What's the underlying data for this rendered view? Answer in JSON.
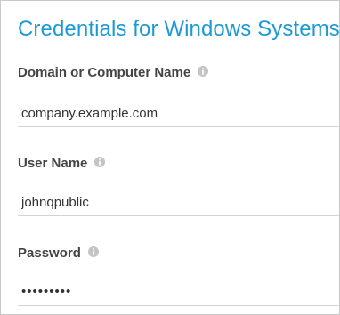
{
  "form": {
    "title": "Credentials for Windows Systems",
    "fields": [
      {
        "label": "Domain or Computer Name",
        "value": "company.example.com",
        "type": "text",
        "info_icon": "info-icon"
      },
      {
        "label": "User Name",
        "value": "johnqpublic",
        "type": "text",
        "info_icon": "info-icon"
      },
      {
        "label": "Password",
        "value": "•••••••••",
        "type": "password",
        "info_icon": "info-icon"
      }
    ]
  },
  "colors": {
    "title": "#1d9ad6",
    "label": "#444444",
    "info_icon": "#c4c4c4",
    "input_border": "#d3d3d3",
    "panel_border": "#c9c9c9"
  }
}
